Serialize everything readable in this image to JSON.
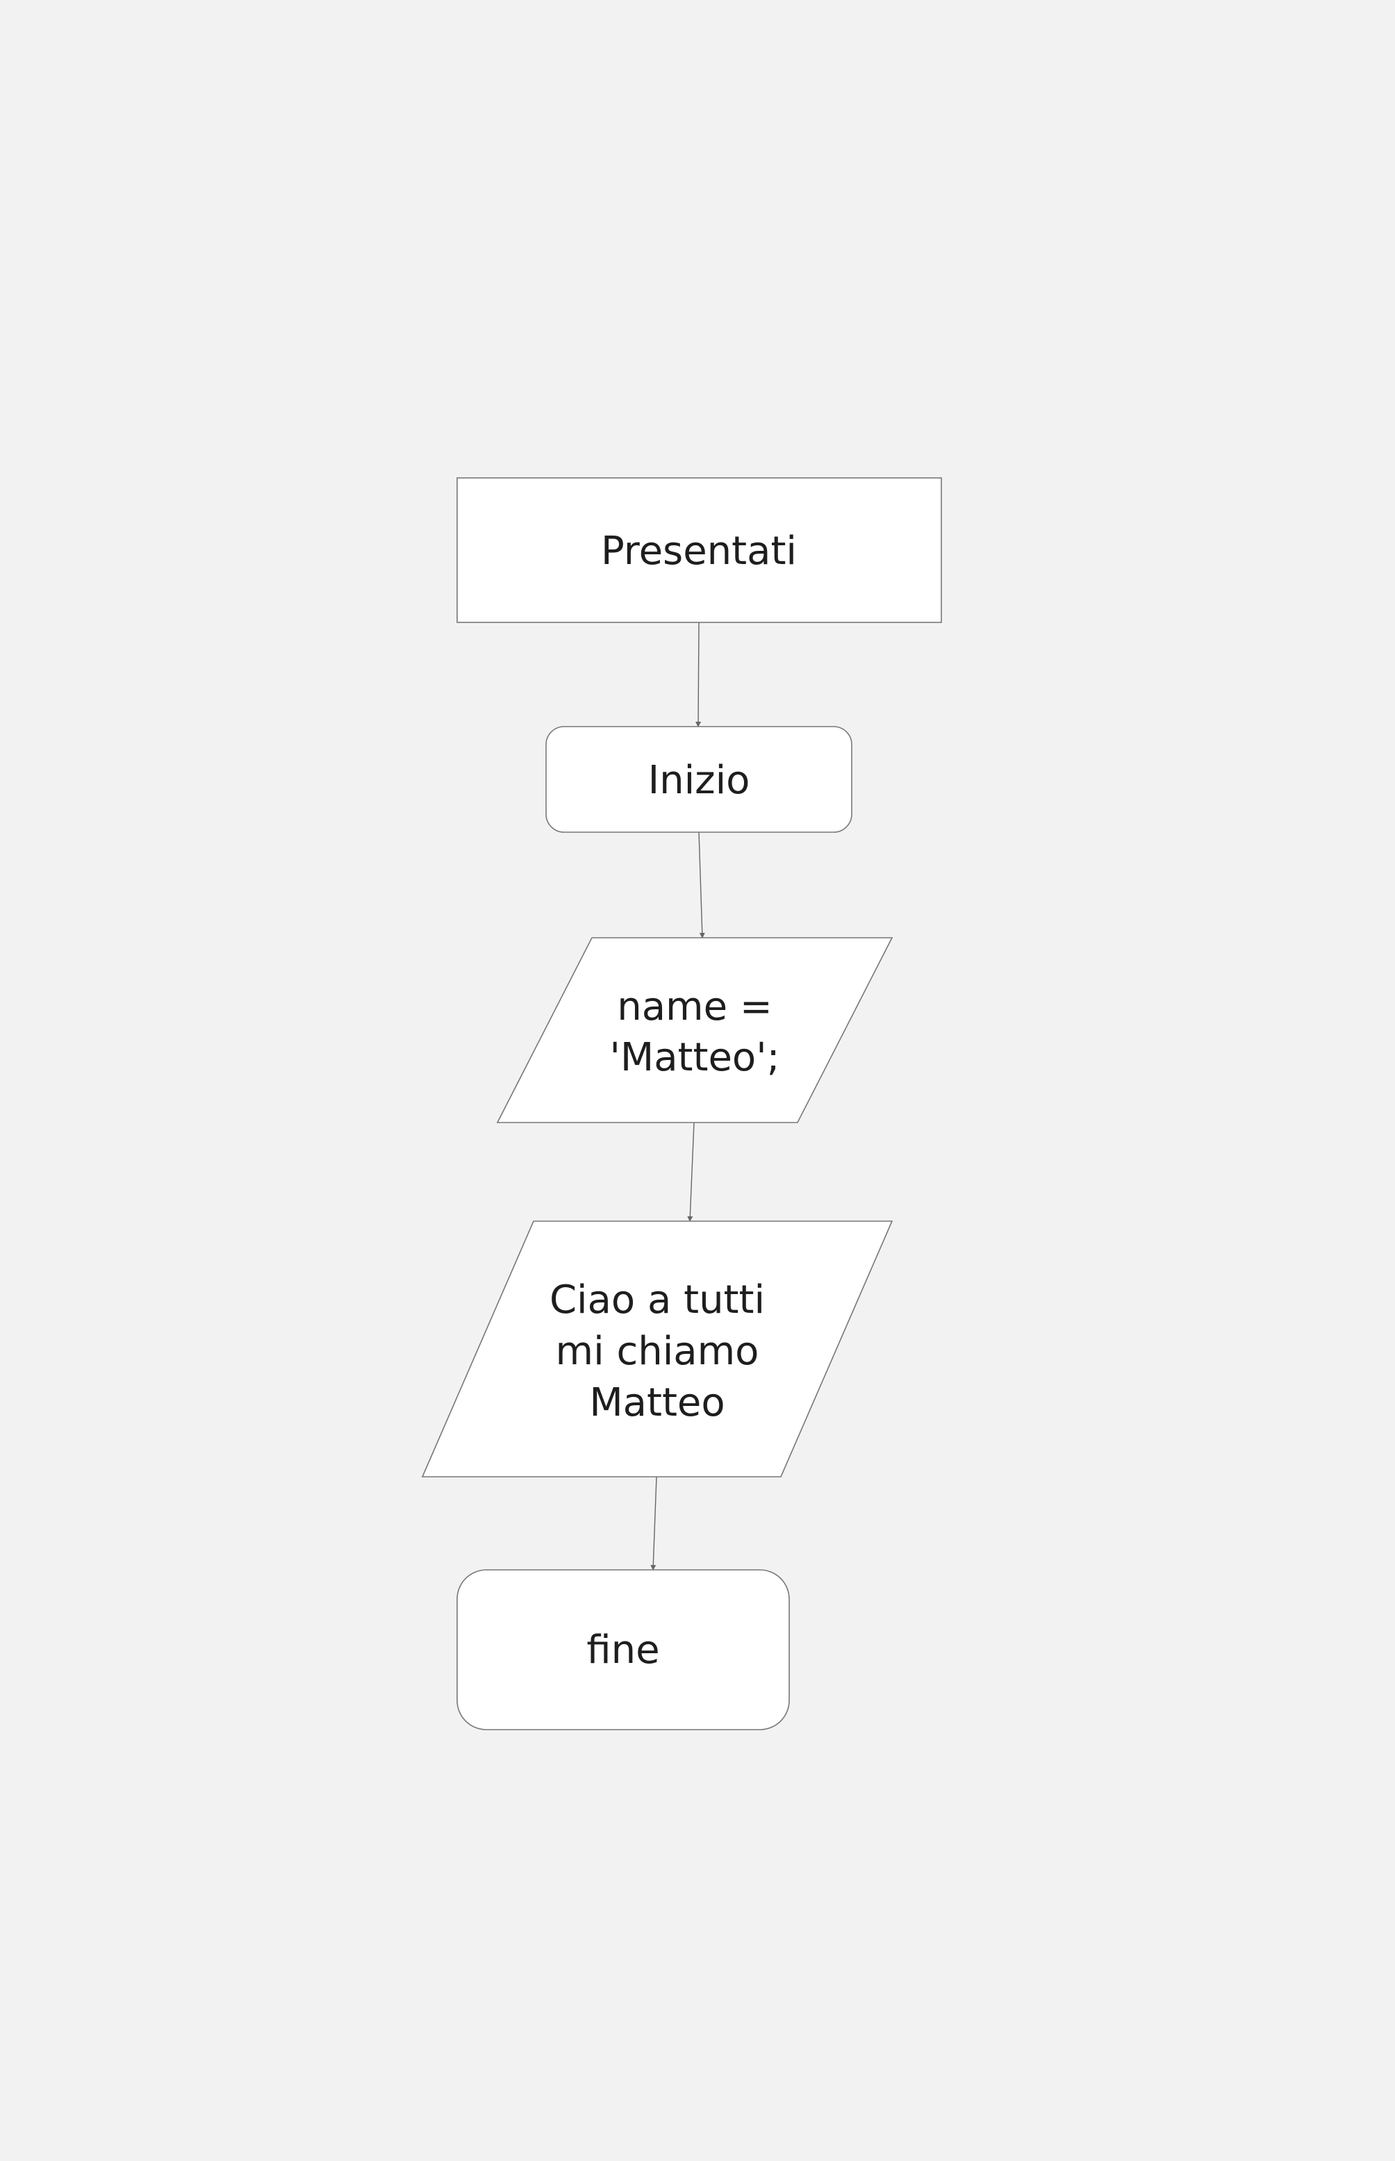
{
  "diagram": {
    "nodes": {
      "presentati": {
        "shape": "rectangle",
        "label": "Presentati"
      },
      "inizio": {
        "shape": "rounded-rectangle",
        "label": "Inizio"
      },
      "assign": {
        "shape": "parallelogram",
        "lines": [
          "name =",
          "'Matteo';"
        ]
      },
      "output": {
        "shape": "parallelogram",
        "lines": [
          "Ciao a tutti",
          "mi chiamo",
          "Matteo"
        ]
      },
      "fine": {
        "shape": "rounded-rectangle",
        "label": "fine"
      }
    },
    "edges": [
      {
        "from": "presentati",
        "to": "inizio"
      },
      {
        "from": "inizio",
        "to": "assign"
      },
      {
        "from": "assign",
        "to": "output"
      },
      {
        "from": "output",
        "to": "fine"
      }
    ],
    "colors": {
      "background": "#f2f2f2",
      "node_fill": "#ffffff",
      "node_stroke": "#777777",
      "text": "#1e1e1e",
      "connector": "#666666"
    }
  }
}
